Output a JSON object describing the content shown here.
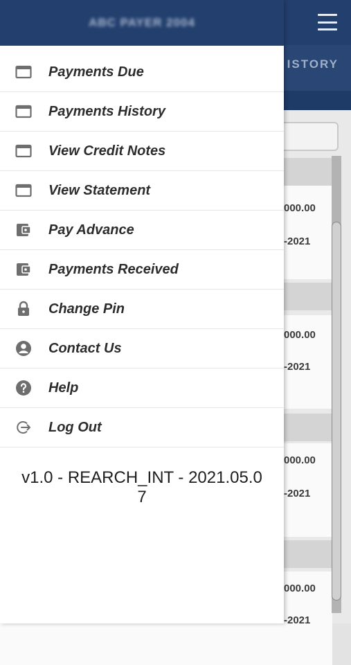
{
  "drawer": {
    "title": "ABC PAYER 2004",
    "menu": [
      {
        "label": "Payments Due",
        "icon": "card-outline-icon"
      },
      {
        "label": "Payments History",
        "icon": "card-outline-icon"
      },
      {
        "label": "View Credit Notes",
        "icon": "card-outline-icon"
      },
      {
        "label": "View Statement",
        "icon": "card-outline-icon"
      },
      {
        "label": "Pay Advance",
        "icon": "wallet-icon"
      },
      {
        "label": "Payments Received",
        "icon": "wallet-icon"
      },
      {
        "label": "Change Pin",
        "icon": "lock-icon"
      },
      {
        "label": "Contact Us",
        "icon": "account-circle-icon"
      },
      {
        "label": "Help",
        "icon": "help-circle-icon"
      },
      {
        "label": "Log Out",
        "icon": "logout-icon"
      }
    ],
    "version_line1": "v1.0 - REARCH_INT - 2021.05.0",
    "version_line2": "7"
  },
  "background": {
    "tab_label": "ISTORY",
    "cards": [
      {
        "amount": "000.00",
        "date": "-2021"
      },
      {
        "amount": "000.00",
        "date": "-2021"
      },
      {
        "amount": "000.00",
        "date": "-2021"
      },
      {
        "amount": "000.00",
        "date": "-2021"
      }
    ]
  },
  "colors": {
    "header": "#223f6e",
    "icon_gray": "#6e6e6e",
    "text": "#2c2c2c"
  }
}
